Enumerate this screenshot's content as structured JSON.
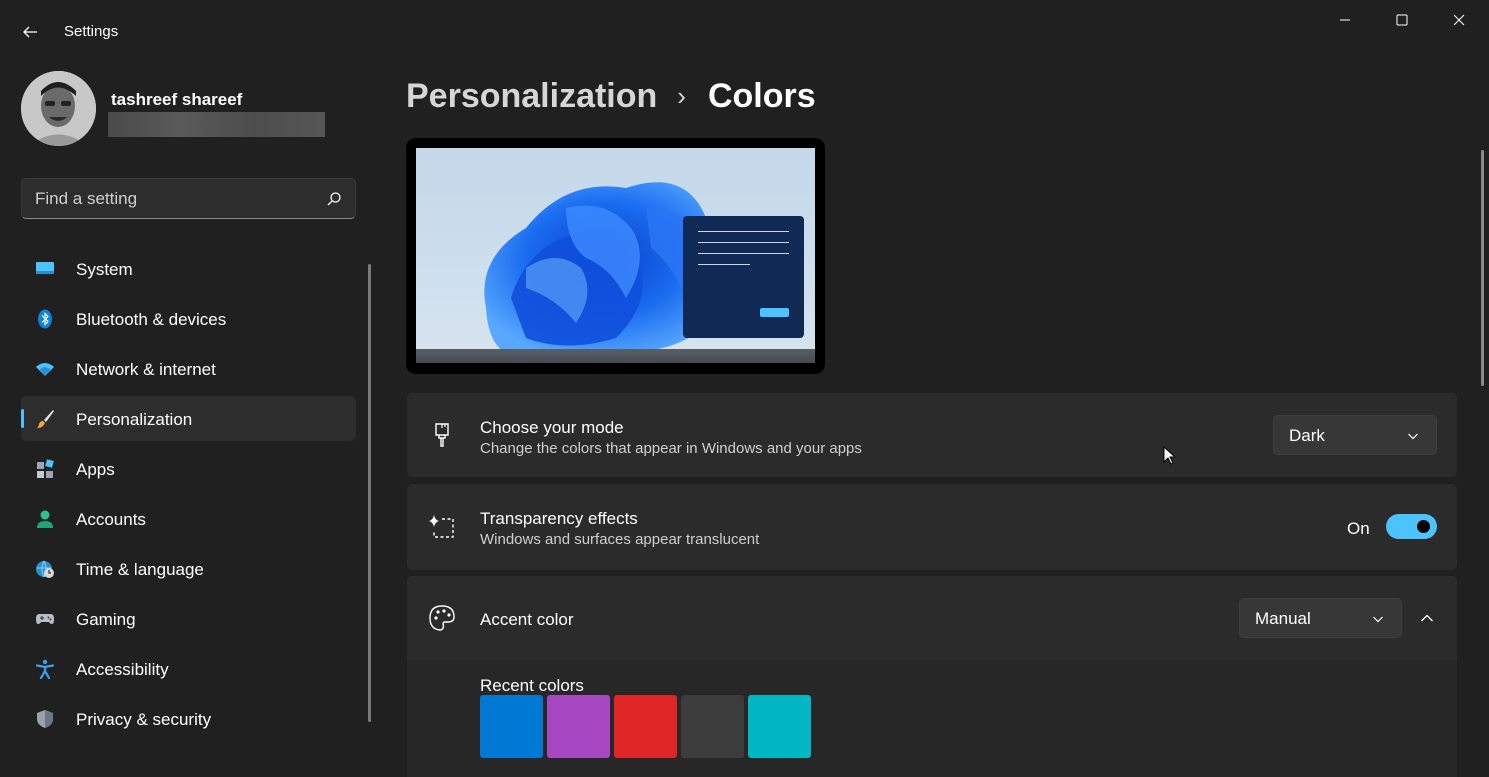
{
  "window": {
    "title": "Settings"
  },
  "user": {
    "name": "tashreef shareef"
  },
  "search": {
    "placeholder": "Find a setting"
  },
  "sidebar": {
    "items": [
      {
        "label": "System",
        "icon": "system-icon"
      },
      {
        "label": "Bluetooth & devices",
        "icon": "bluetooth-icon"
      },
      {
        "label": "Network & internet",
        "icon": "wifi-icon"
      },
      {
        "label": "Personalization",
        "icon": "paintbrush-icon",
        "active": true
      },
      {
        "label": "Apps",
        "icon": "apps-icon"
      },
      {
        "label": "Accounts",
        "icon": "accounts-icon"
      },
      {
        "label": "Time & language",
        "icon": "globe-clock-icon"
      },
      {
        "label": "Gaming",
        "icon": "gamepad-icon"
      },
      {
        "label": "Accessibility",
        "icon": "accessibility-icon"
      },
      {
        "label": "Privacy & security",
        "icon": "shield-icon"
      }
    ]
  },
  "breadcrumb": {
    "parent": "Personalization",
    "separator": "›",
    "current": "Colors"
  },
  "mode": {
    "title": "Choose your mode",
    "description": "Change the colors that appear in Windows and your apps",
    "value": "Dark"
  },
  "transparency": {
    "title": "Transparency effects",
    "description": "Windows and surfaces appear translucent",
    "state_label": "On",
    "enabled": true
  },
  "accent": {
    "title": "Accent color",
    "value": "Manual",
    "recent_label": "Recent colors",
    "recent_colors": [
      "#0078d4",
      "#a748c2",
      "#e02525",
      "#3c3c3c",
      "#00b7c3"
    ]
  },
  "colors": {
    "accent": "#4cc2ff",
    "background": "#202020",
    "card": "#2b2b2b"
  }
}
